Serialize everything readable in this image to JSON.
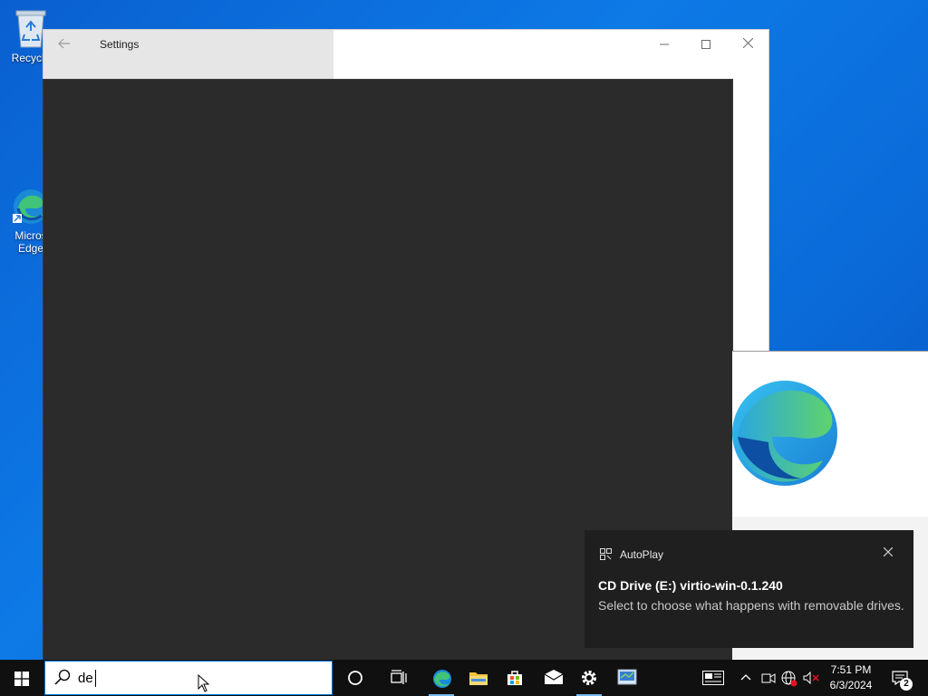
{
  "desktop": {
    "icons": [
      {
        "label": "Recycle"
      },
      {
        "label": "Micros Edge"
      }
    ]
  },
  "settings": {
    "title": "Settings",
    "back_icon": "back-arrow-icon",
    "controls": [
      "minimize-icon",
      "maximize-icon",
      "close-icon"
    ]
  },
  "toast": {
    "app_name": "AutoPlay",
    "title": "CD Drive (E:) virtio-win-0.1.240",
    "body": "Select to choose what happens with removable drives.",
    "close_icon": "close-icon"
  },
  "taskbar": {
    "search_value": "de",
    "apps": [
      "cortana-icon",
      "task-view-icon",
      "edge-icon",
      "file-explorer-icon",
      "store-icon",
      "mail-icon",
      "settings-gear-icon",
      "control-panel-icon"
    ],
    "tray": [
      "news-icon",
      "chevron-up-icon",
      "meet-now-icon",
      "network-icon",
      "volume-muted-icon"
    ],
    "time": "7:51 PM",
    "date": "6/3/2024",
    "notifications_count": "2"
  },
  "colors": {
    "accent": "#0078d7",
    "desktop": "#0a6ad8",
    "dark_panel": "#2b2b2b",
    "toast_bg": "#1f1f1f",
    "taskbar": "#101010"
  }
}
